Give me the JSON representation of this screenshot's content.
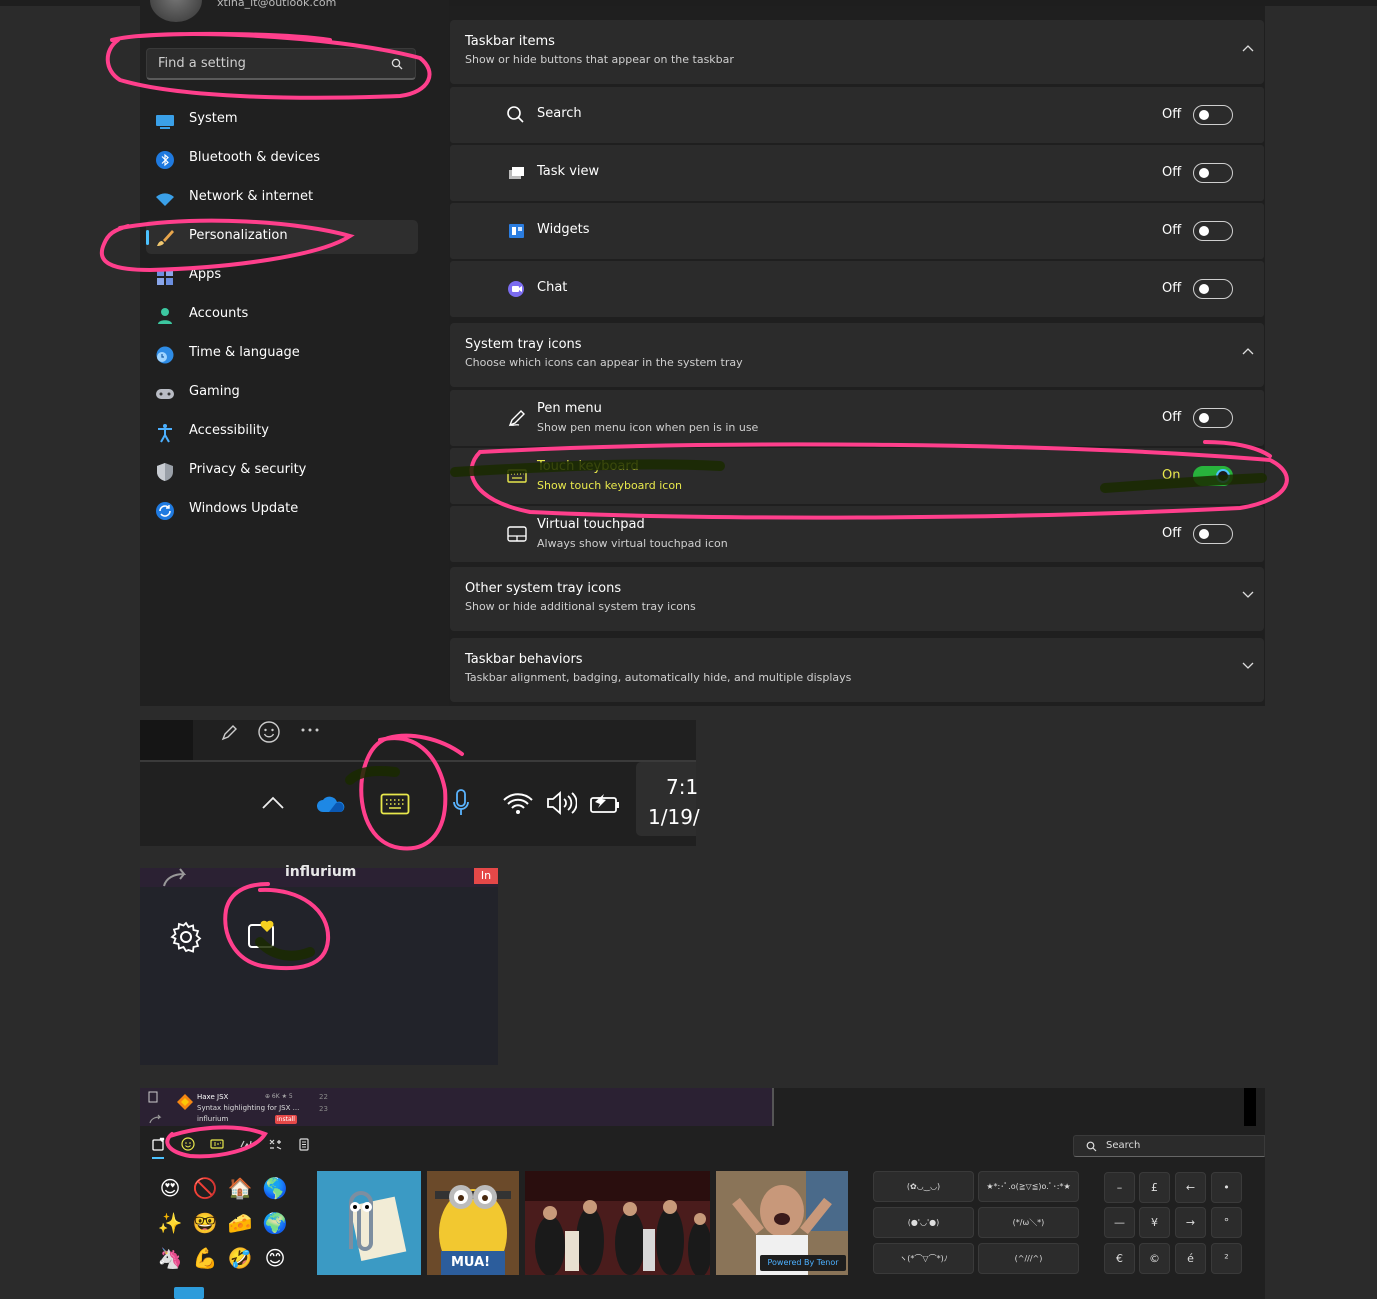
{
  "settings": {
    "account_email": "xtina_it@outlook.com",
    "search_placeholder": "Find a setting",
    "nav": [
      {
        "label": "System",
        "icon": "system-icon"
      },
      {
        "label": "Bluetooth & devices",
        "icon": "bluetooth-icon"
      },
      {
        "label": "Network & internet",
        "icon": "wifi-icon"
      },
      {
        "label": "Personalization",
        "icon": "brush-icon",
        "selected": true
      },
      {
        "label": "Apps",
        "icon": "apps-icon"
      },
      {
        "label": "Accounts",
        "icon": "accounts-icon"
      },
      {
        "label": "Time & language",
        "icon": "globe-clock-icon"
      },
      {
        "label": "Gaming",
        "icon": "gamepad-icon"
      },
      {
        "label": "Accessibility",
        "icon": "accessibility-icon"
      },
      {
        "label": "Privacy & security",
        "icon": "shield-icon"
      },
      {
        "label": "Windows Update",
        "icon": "update-icon"
      }
    ],
    "taskbar_items": {
      "title": "Taskbar items",
      "subtitle": "Show or hide buttons that appear on the taskbar",
      "rows": [
        {
          "label": "Search",
          "state": "Off",
          "icon": "search-icon"
        },
        {
          "label": "Task view",
          "state": "Off",
          "icon": "task-view-icon"
        },
        {
          "label": "Widgets",
          "state": "Off",
          "icon": "widgets-icon"
        },
        {
          "label": "Chat",
          "state": "Off",
          "icon": "chat-icon"
        }
      ]
    },
    "system_tray": {
      "title": "System tray icons",
      "subtitle": "Choose which icons can appear in the system tray",
      "rows": [
        {
          "label": "Pen menu",
          "desc": "Show pen menu icon when pen is in use",
          "state": "Off",
          "icon": "pen-icon"
        },
        {
          "label": "Touch keyboard",
          "desc": "Show touch keyboard icon",
          "state": "On",
          "icon": "keyboard-icon"
        },
        {
          "label": "Virtual touchpad",
          "desc": "Always show virtual touchpad icon",
          "state": "Off",
          "icon": "touchpad-icon"
        }
      ]
    },
    "other_tray": {
      "title": "Other system tray icons",
      "subtitle": "Show or hide additional system tray icons"
    },
    "behaviors": {
      "title": "Taskbar behaviors",
      "subtitle": "Taskbar alignment, badging, automatically hide, and multiple displays"
    }
  },
  "taskbar": {
    "time": "7:1",
    "date": "1/19/"
  },
  "widget": {
    "name": "influrium",
    "pill": "In"
  },
  "emoji_panel": {
    "store_card": {
      "title": "Haxe JSX",
      "subtitle": "Syntax highlighting for JSX ...",
      "author": "influrium",
      "stats": "⊕ 6K ★ 5",
      "install": "install",
      "n1": "22",
      "n2": "23"
    },
    "search_placeholder": "Search",
    "emojis": [
      "😍",
      "🚫",
      "🏠",
      "🌎",
      "✨",
      "🤓",
      "🧀",
      "🌍",
      "🦄",
      "💪",
      "🤣",
      "😊"
    ],
    "gifs": [
      "clippy",
      "minion",
      "celebration",
      "excited"
    ],
    "gif_caption_minion": "MUA!",
    "gif_caption_tenor": "Powered By Tenor",
    "kaomoji": [
      "(✿◡‿◡)",
      "★*:･ﾟ.o(≧▽≦)o.ﾟ･:*★",
      "(●'◡'●)",
      "(*/ω＼*)",
      "ヽ(*⌒▽⌒*)ﾉ",
      "(^///^)"
    ],
    "symbols": [
      "–",
      "£",
      "←",
      "•",
      "—",
      "¥",
      "→",
      "°",
      "€",
      "©",
      "é",
      "²"
    ]
  }
}
